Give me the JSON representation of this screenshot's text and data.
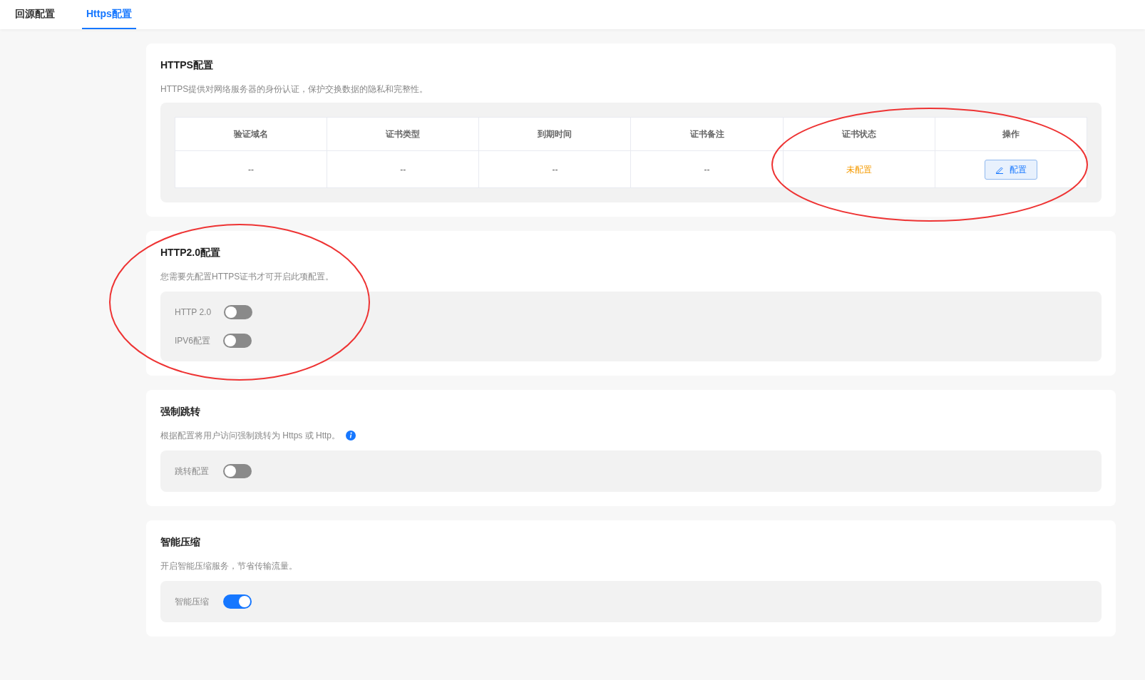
{
  "tabs": [
    {
      "label": "回源配置",
      "selected": false
    },
    {
      "label": "Https配置",
      "selected": true
    }
  ],
  "sections": [
    {
      "kind": "table",
      "title": "HTTPS配置",
      "description": "HTTPS提供对网络服务器的身份认证，保护交换数据的隐私和完整性。",
      "info": false,
      "table": {
        "columns": [
          "验证域名",
          "证书类型",
          "到期时间",
          "证书备注",
          "证书状态",
          "操作"
        ],
        "rows": [
          {
            "domain": "--",
            "cert_type": "--",
            "expiry": "--",
            "note": "--",
            "status": "未配置",
            "action": "配置"
          }
        ]
      }
    },
    {
      "kind": "toggles",
      "title": "HTTP2.0配置",
      "description": "您需要先配置HTTPS证书才可开启此项配置。",
      "info": false,
      "toggles": [
        {
          "label": "HTTP 2.0",
          "on": false
        },
        {
          "label": "IPV6配置",
          "on": false
        }
      ]
    },
    {
      "kind": "toggles",
      "title": "强制跳转",
      "description": "根据配置将用户访问强制跳转为 Https 或 Http。",
      "info": true,
      "toggles": [
        {
          "label": "跳转配置",
          "on": false
        }
      ]
    },
    {
      "kind": "toggles",
      "title": "智能压缩",
      "description": "开启智能压缩服务，节省传输流量。",
      "info": false,
      "toggles": [
        {
          "label": "智能压缩",
          "on": true
        }
      ]
    }
  ]
}
